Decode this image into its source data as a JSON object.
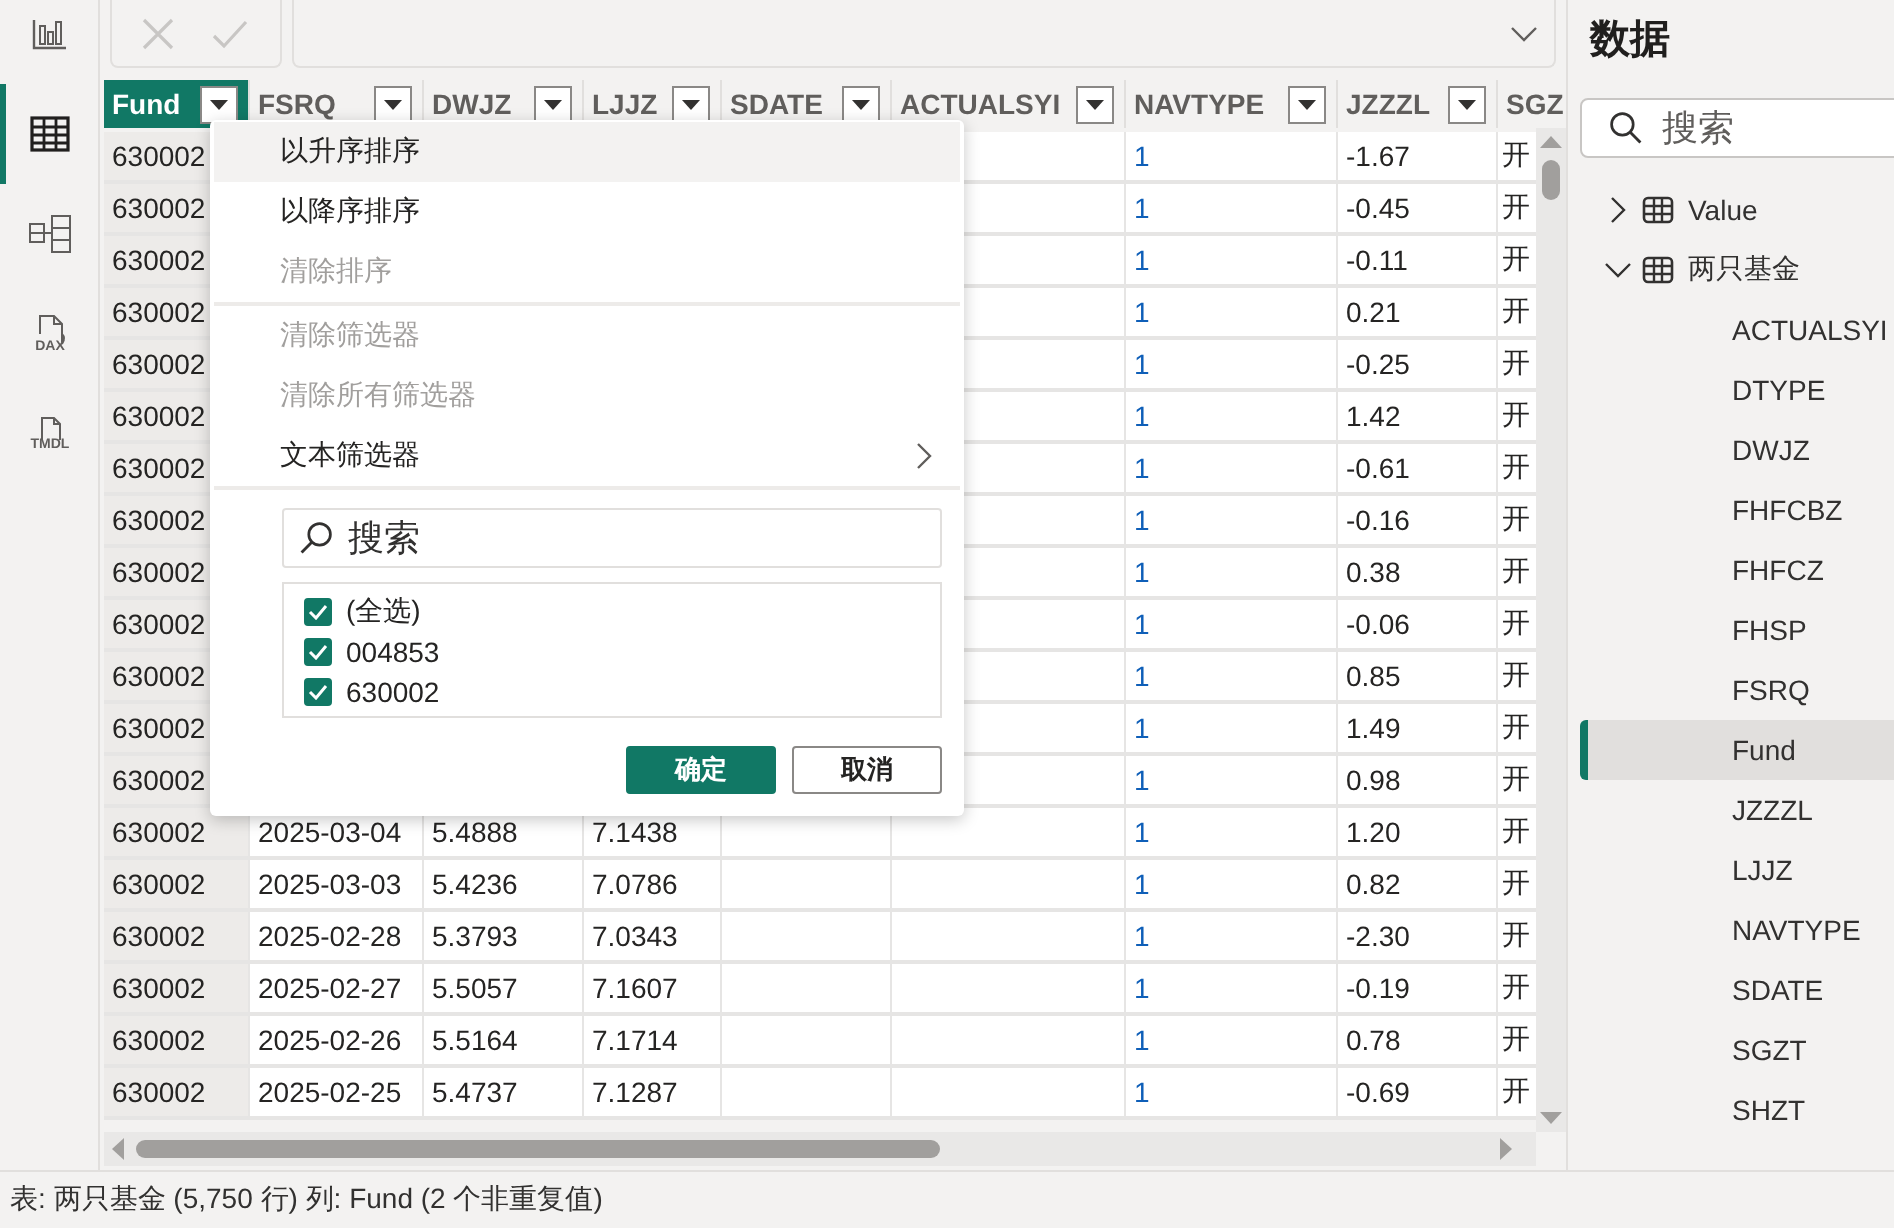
{
  "nav_rail": [
    {
      "kind": "report",
      "selected": false
    },
    {
      "kind": "table",
      "selected": true
    },
    {
      "kind": "model",
      "selected": false
    },
    {
      "kind": "dax",
      "label": "DAX",
      "selected": false
    },
    {
      "kind": "tmdl",
      "label": "TMDL",
      "selected": false
    }
  ],
  "formula_bar": {
    "buttons": [
      {
        "kind": "cancel",
        "disabled": true
      },
      {
        "kind": "commit",
        "disabled": true
      }
    ]
  },
  "table": {
    "columns": [
      {
        "label": "Fund",
        "selected": true,
        "filter": true
      },
      {
        "label": "FSRQ",
        "selected": false,
        "filter": true
      },
      {
        "label": "DWJZ",
        "selected": false,
        "filter": true
      },
      {
        "label": "LJJZ",
        "selected": false,
        "filter": true
      },
      {
        "label": "SDATE",
        "selected": false,
        "filter": true
      },
      {
        "label": "ACTUALSYI",
        "selected": false,
        "filter": true
      },
      {
        "label": "NAVTYPE",
        "selected": false,
        "filter": true
      },
      {
        "label": "JZZZL",
        "selected": false,
        "filter": true
      },
      {
        "label": "SGZ",
        "selected": false,
        "filter": false
      }
    ],
    "rows": [
      {
        "cells": [
          "630002",
          null,
          null,
          null,
          null,
          null,
          "1",
          "-1.67",
          "开"
        ]
      },
      {
        "cells": [
          "630002",
          null,
          null,
          null,
          null,
          null,
          "1",
          "-0.45",
          "开"
        ]
      },
      {
        "cells": [
          "630002",
          null,
          null,
          null,
          null,
          null,
          "1",
          "-0.11",
          "开"
        ]
      },
      {
        "cells": [
          "630002",
          null,
          null,
          null,
          null,
          null,
          "1",
          "0.21",
          "开"
        ]
      },
      {
        "cells": [
          "630002",
          null,
          null,
          null,
          null,
          null,
          "1",
          "-0.25",
          "开"
        ]
      },
      {
        "cells": [
          "630002",
          null,
          null,
          null,
          null,
          null,
          "1",
          "1.42",
          "开"
        ]
      },
      {
        "cells": [
          "630002",
          null,
          null,
          null,
          null,
          null,
          "1",
          "-0.61",
          "开"
        ]
      },
      {
        "cells": [
          "630002",
          null,
          null,
          null,
          null,
          null,
          "1",
          "-0.16",
          "开"
        ]
      },
      {
        "cells": [
          "630002",
          null,
          null,
          null,
          null,
          null,
          "1",
          "0.38",
          "开"
        ]
      },
      {
        "cells": [
          "630002",
          null,
          null,
          null,
          null,
          null,
          "1",
          "-0.06",
          "开"
        ]
      },
      {
        "cells": [
          "630002",
          null,
          null,
          null,
          null,
          null,
          "1",
          "0.85",
          "开"
        ]
      },
      {
        "cells": [
          "630002",
          null,
          null,
          null,
          null,
          null,
          "1",
          "1.49",
          "开"
        ]
      },
      {
        "cells": [
          "630002",
          null,
          null,
          null,
          null,
          null,
          "1",
          "0.98",
          "开"
        ]
      },
      {
        "cells": [
          "630002",
          "2025-03-04",
          "5.4888",
          "7.1438",
          null,
          null,
          "1",
          "1.20",
          "开"
        ]
      },
      {
        "cells": [
          "630002",
          "2025-03-03",
          "5.4236",
          "7.0786",
          null,
          null,
          "1",
          "0.82",
          "开"
        ]
      },
      {
        "cells": [
          "630002",
          "2025-02-28",
          "5.3793",
          "7.0343",
          null,
          null,
          "1",
          "-2.30",
          "开"
        ]
      },
      {
        "cells": [
          "630002",
          "2025-02-27",
          "5.5057",
          "7.1607",
          null,
          null,
          "1",
          "-0.19",
          "开"
        ]
      },
      {
        "cells": [
          "630002",
          "2025-02-26",
          "5.5164",
          "7.1714",
          null,
          null,
          "1",
          "0.78",
          "开"
        ]
      },
      {
        "cells": [
          "630002",
          "2025-02-25",
          "5.4737",
          "7.1287",
          null,
          null,
          "1",
          "-0.69",
          "开"
        ]
      }
    ]
  },
  "filter_menu": {
    "groups": [
      [
        {
          "label": "以升序排序",
          "hovered": true,
          "disabled": false,
          "kind": "action"
        },
        {
          "label": "以降序排序",
          "hovered": false,
          "disabled": false,
          "kind": "action"
        },
        {
          "label": "清除排序",
          "hovered": false,
          "disabled": true,
          "kind": "action"
        }
      ],
      [
        {
          "label": "清除筛选器",
          "hovered": false,
          "disabled": true,
          "kind": "action"
        },
        {
          "label": "清除所有筛选器",
          "hovered": false,
          "disabled": true,
          "kind": "action"
        },
        {
          "label": "文本筛选器",
          "hovered": false,
          "disabled": false,
          "kind": "submenu"
        }
      ]
    ],
    "search": {
      "placeholder": "搜索"
    },
    "values": [
      {
        "label": "(全选)",
        "checked": true
      },
      {
        "label": "004853",
        "checked": true
      },
      {
        "label": "630002",
        "checked": true
      }
    ],
    "buttons": [
      {
        "label": "确定",
        "kind": "primary"
      },
      {
        "label": "取消",
        "kind": "secondary"
      }
    ]
  },
  "data_pane": {
    "title": "数据",
    "search": {
      "placeholder": "搜索"
    },
    "tables": [
      {
        "name": "Value",
        "expanded": false
      },
      {
        "name": "两只基金",
        "expanded": true,
        "children": [
          {
            "name": "ACTUALSYI",
            "selected": false
          },
          {
            "name": "DTYPE",
            "selected": false
          },
          {
            "name": "DWJZ",
            "selected": false
          },
          {
            "name": "FHFCBZ",
            "selected": false
          },
          {
            "name": "FHFCZ",
            "selected": false
          },
          {
            "name": "FHSP",
            "selected": false
          },
          {
            "name": "FSRQ",
            "selected": false
          },
          {
            "name": "Fund",
            "selected": true
          },
          {
            "name": "JZZZL",
            "selected": false
          },
          {
            "name": "LJJZ",
            "selected": false
          },
          {
            "name": "NAVTYPE",
            "selected": false
          },
          {
            "name": "SDATE",
            "selected": false
          },
          {
            "name": "SGZT",
            "selected": false
          },
          {
            "name": "SHZT",
            "selected": false
          }
        ]
      }
    ]
  },
  "status_bar": {
    "text": "表: 两只基金 (5,750 行) 列: Fund (2 个非重复值)"
  }
}
